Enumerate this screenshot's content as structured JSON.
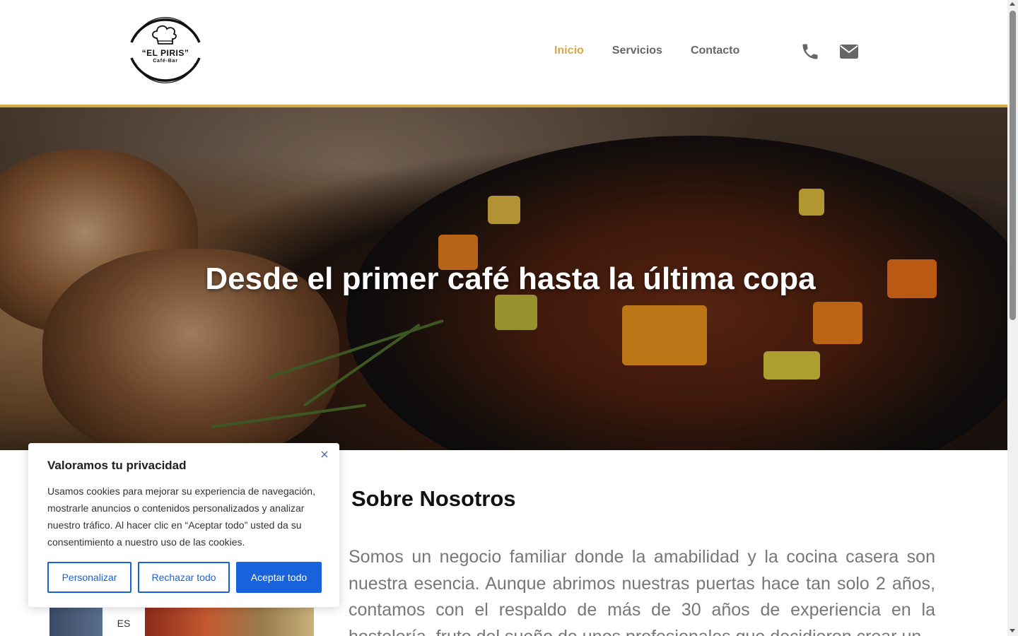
{
  "header": {
    "logo": {
      "title": "“EL PIRIS”",
      "subtitle": "Café-Bar",
      "icon": "chef-hat-icon"
    },
    "nav": [
      {
        "label": "Inicio",
        "active": true
      },
      {
        "label": "Servicios",
        "active": false
      },
      {
        "label": "Contacto",
        "active": false
      }
    ],
    "contact_icons": [
      "phone-icon",
      "mail-icon"
    ]
  },
  "hero": {
    "headline": "Desde el primer café hasta la última copa"
  },
  "about": {
    "title": "Sobre Nosotros",
    "text": "Somos un negocio familiar donde la amabilidad y la cocina casera son nuestra esencia. Aunque abrimos nuestras puertas hace tan solo 2 años, contamos con el respaldo de más de 30 años de experiencia en la hostelería, fruto del sueño de unos profesionales que decidieron crear un"
  },
  "language": {
    "current": "ES"
  },
  "cookie_banner": {
    "title": "Valoramos tu privacidad",
    "body": "Usamos cookies para mejorar su experiencia de navegación, mostrarle anuncios o contenidos personalizados y analizar nuestro tráfico. Al hacer clic en “Aceptar todo” usted da su consentimiento a nuestro uso de las cookies.",
    "close_icon": "close-icon",
    "buttons": {
      "customize": "Personalizar",
      "reject": "Rechazar todo",
      "accept": "Aceptar todo"
    }
  },
  "colors": {
    "accent_gold": "#d4a846",
    "nav_text": "#666666",
    "cookie_primary": "#1863dc"
  }
}
